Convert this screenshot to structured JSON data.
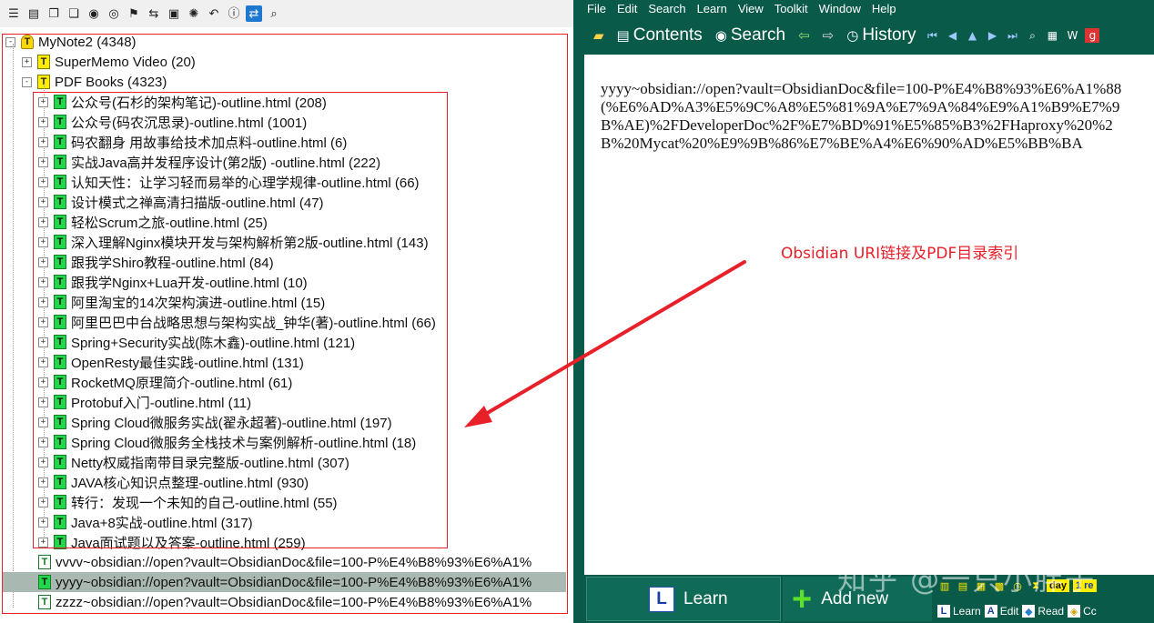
{
  "left_toolbar": {
    "icons": [
      "list-icon",
      "document-icon",
      "copy-icon",
      "copy2-icon",
      "binoculars-icon",
      "eye-icon",
      "flag-icon",
      "swap-icon",
      "save-icon",
      "bulb-icon",
      "undo-icon",
      "info-icon",
      "sync-icon",
      "zoom-icon"
    ]
  },
  "tree": {
    "root": {
      "label": "MyNote2 (4348)"
    },
    "folders": [
      {
        "label": "SuperMemo Video (20)"
      },
      {
        "label": "PDF Books (4323)"
      }
    ],
    "pdf_books": [
      "公众号(石杉的架构笔记)-outline.html (208)",
      "公众号(码农沉思录)-outline.html (1001)",
      "码农翻身 用故事给技术加点料-outline.html (6)",
      "实战Java高并发程序设计(第2版) -outline.html (222)",
      "认知天性：让学习轻而易举的心理学规律-outline.html (66)",
      "设计模式之禅高清扫描版-outline.html (47)",
      "轻松Scrum之旅-outline.html (25)",
      "深入理解Nginx模块开发与架构解析第2版-outline.html (143)",
      "跟我学Shiro教程-outline.html (84)",
      "跟我学Nginx+Lua开发-outline.html (10)",
      "阿里淘宝的14次架构演进-outline.html (15)",
      "阿里巴巴中台战略思想与架构实战_钟华(著)-outline.html (66)",
      "Spring+Security实战(陈木鑫)-outline.html (121)",
      "OpenResty最佳实践-outline.html (131)",
      "RocketMQ原理简介-outline.html (61)",
      "Protobuf入门-outline.html (11)",
      "Spring Cloud微服务实战(翟永超著)-outline.html (197)",
      "Spring Cloud微服务全栈技术与案例解析-outline.html (18)",
      "Netty权威指南带目录完整版-outline.html (307)",
      "JAVA核心知识点整理-outline.html (930)",
      "转行：发现一个未知的自己-outline.html (55)",
      "Java+8实战-outline.html (317)",
      "Java面试题以及答案-outline.html (259)"
    ],
    "topics": [
      "vvvv~obsidian://open?vault=ObsidianDoc&file=100-P%E4%B8%93%E6%A1%",
      "yyyy~obsidian://open?vault=ObsidianDoc&file=100-P%E4%B8%93%E6%A1%",
      "zzzz~obsidian://open?vault=ObsidianDoc&file=100-P%E4%B8%93%E6%A1%"
    ],
    "selected_index": 1
  },
  "menu": [
    "File",
    "Edit",
    "Search",
    "Learn",
    "View",
    "Toolkit",
    "Window",
    "Help"
  ],
  "nav": {
    "contents": "Contents",
    "search": "Search",
    "history": "History"
  },
  "content": {
    "text": "yyyy~obsidian://open?vault=ObsidianDoc&file=100-P%E4%B8%93%E6%A1%88(%E6%AD%A3%E5%9C%A8%E5%81%9A%E7%9A%84%E9%A1%B9%E7%9B%AE)%2FDeveloperDoc%2F%E7%BD%91%E5%85%B3%2FHaproxy%20%2B%20Mycat%20%E9%9B%86%E7%BE%A4%E6%90%AD%E5%BB%BA"
  },
  "annotation": "Obsidian URI链接及PDF目录索引",
  "bottom": {
    "learn": "Learn",
    "add_new": "Add new",
    "tray_day": "day",
    "tray_re": "1 re",
    "tray_learn": "Learn",
    "tray_edit": "Edit",
    "tray_read": "Read",
    "tray_co": "Cc"
  },
  "watermark": "知乎 @一只小胖子",
  "colors": {
    "accent_red": "#e8202a",
    "panel_green": "#0a5a4a",
    "selection": "#a9b9b1"
  }
}
